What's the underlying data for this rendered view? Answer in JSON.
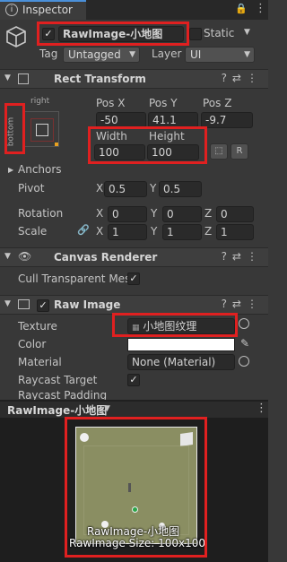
{
  "tab": {
    "title": "Inspector"
  },
  "header": {
    "object_name": "RawImage-小地图",
    "static_label": "Static",
    "tag_label": "Tag",
    "tag_value": "Untagged",
    "layer_label": "Layer",
    "layer_value": "UI"
  },
  "rect_transform": {
    "title": "Rect Transform",
    "anchor_top": "right",
    "anchor_side": "bottom",
    "pos_x_label": "Pos X",
    "pos_y_label": "Pos Y",
    "pos_z_label": "Pos Z",
    "pos_x": "-50",
    "pos_y": "41.1",
    "pos_z": "-9.7",
    "width_label": "Width",
    "height_label": "Height",
    "width": "100",
    "height": "100",
    "r_btn": "R",
    "anchors_label": "Anchors",
    "pivot_label": "Pivot",
    "pivot_x": "0.5",
    "pivot_y": "0.5",
    "rotation_label": "Rotation",
    "rot_x": "0",
    "rot_y": "0",
    "rot_z": "0",
    "scale_label": "Scale",
    "scale_x": "1",
    "scale_y": "1",
    "scale_z": "1",
    "x": "X",
    "y": "Y",
    "z": "Z"
  },
  "canvas_renderer": {
    "title": "Canvas Renderer",
    "cull_label": "Cull Transparent Mes"
  },
  "raw_image": {
    "title": "Raw Image",
    "texture_label": "Texture",
    "texture_value": "小地图纹理",
    "color_label": "Color",
    "color_value": "#ffffff",
    "material_label": "Material",
    "material_value": "None (Material)",
    "raycast_label": "Raycast Target",
    "raycast_padding_label": "Raycast Padding"
  },
  "preview": {
    "title": "RawImage-小地图",
    "caption_line1": "RawImage-小地图",
    "caption_line2": "RawImage Size: 100x100"
  }
}
